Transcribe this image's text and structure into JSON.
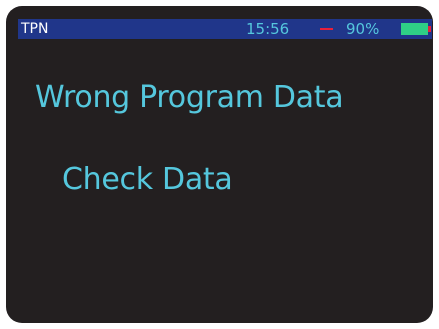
{
  "status_bar": {
    "title": "TPN",
    "time": "15:56",
    "battery_percent": "90%",
    "battery_icon": "battery-icon",
    "colors": {
      "bar_background": "#20368a",
      "time_text": "#55c7dd",
      "dash": "#e8203a",
      "battery_fill": "#2fcf86"
    }
  },
  "message": {
    "primary": "Wrong Program Data",
    "secondary": "Check Data",
    "color": "#55c7dd"
  },
  "screen": {
    "background": "#231f20"
  }
}
